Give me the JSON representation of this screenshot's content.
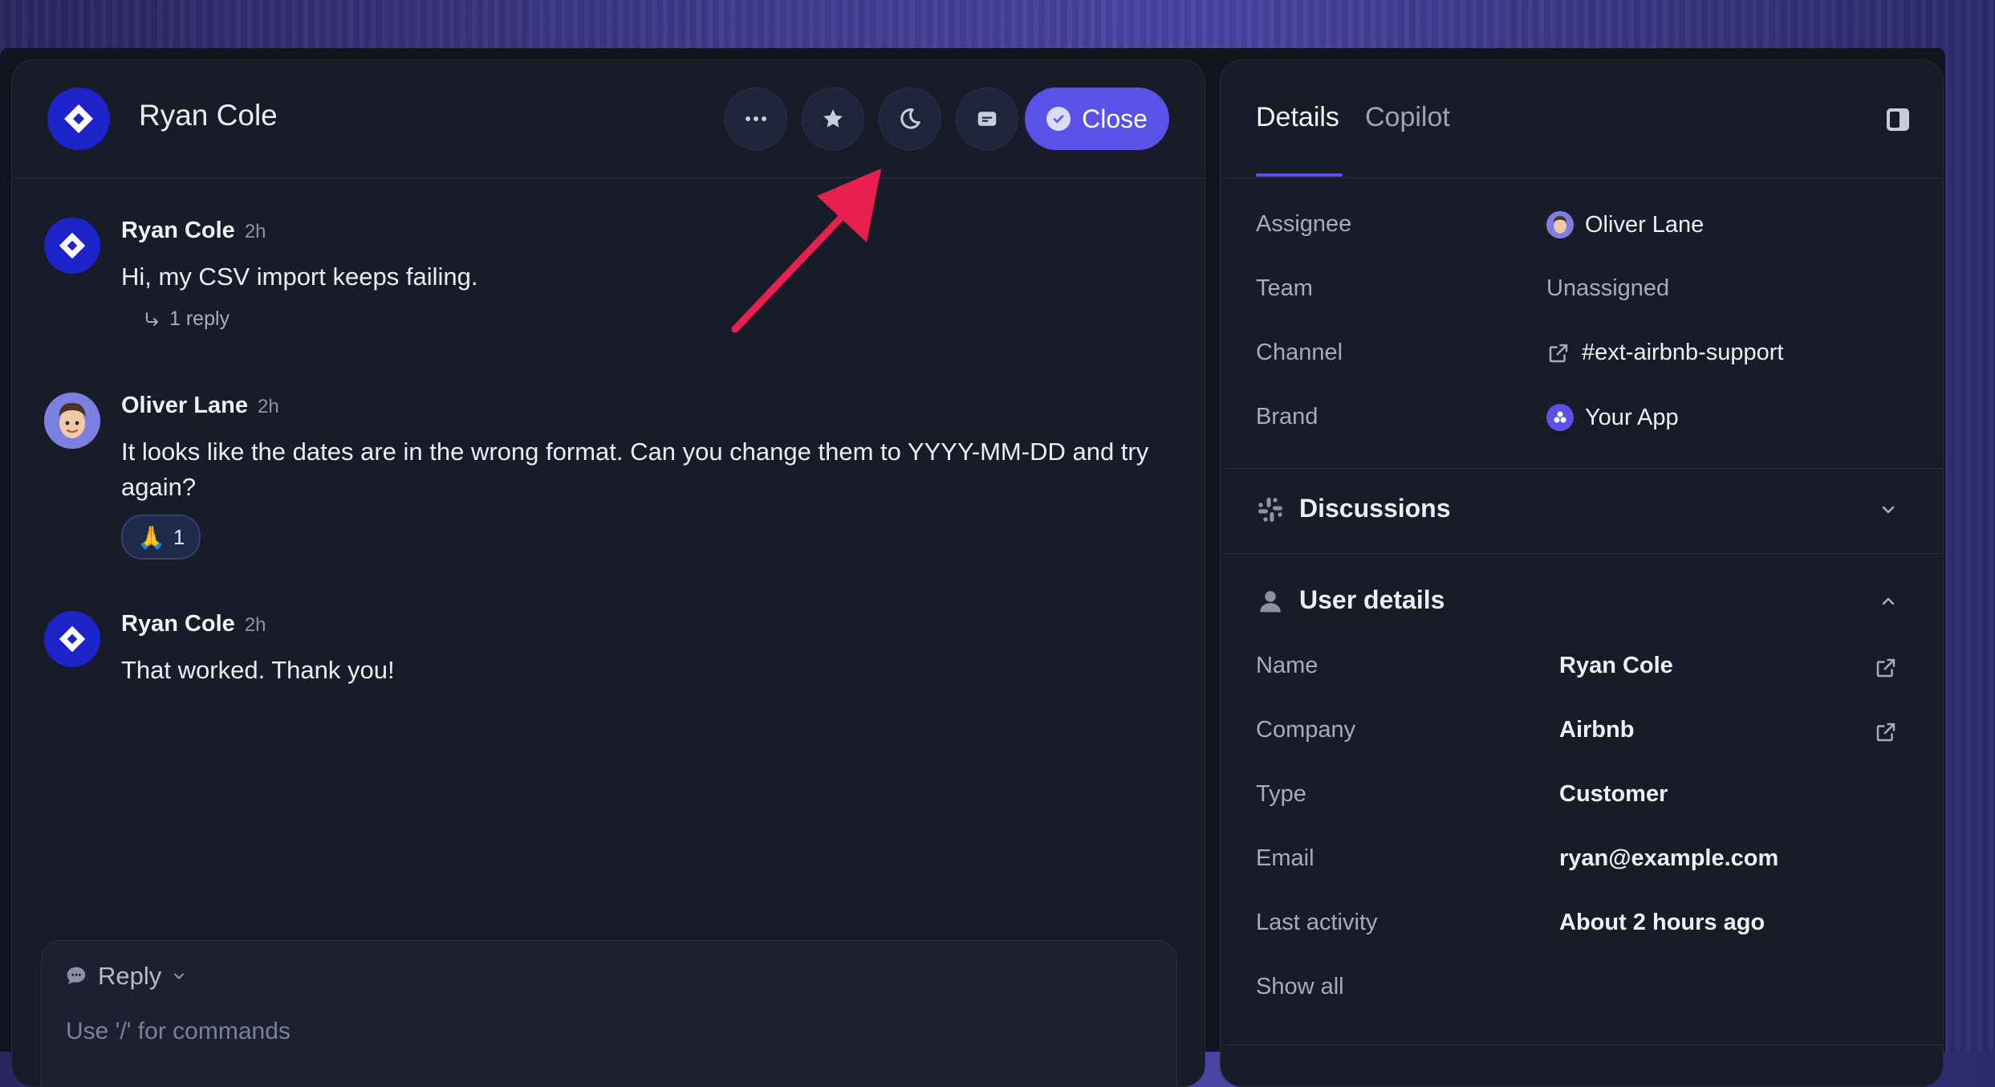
{
  "conversation": {
    "title": "Ryan Cole",
    "close_label": "Close",
    "header_buttons": [
      "more-icon",
      "star-icon",
      "moon-icon",
      "ticket-icon"
    ]
  },
  "messages": [
    {
      "author": "Ryan Cole",
      "time": "2h",
      "body": "Hi, my CSV import keeps failing.",
      "reply_label": "1 reply"
    },
    {
      "author": "Oliver Lane",
      "time": "2h",
      "body": "It looks like the dates are in the wrong format. Can you change them to YYYY-MM-DD and try again?",
      "reaction_emoji": "🙏",
      "reaction_count": "1"
    },
    {
      "author": "Ryan Cole",
      "time": "2h",
      "body": "That worked. Thank you!"
    }
  ],
  "composer": {
    "mode_label": "Reply",
    "placeholder": "Use '/' for commands"
  },
  "details": {
    "tabs": [
      {
        "label": "Details",
        "active": true
      },
      {
        "label": "Copilot",
        "active": false
      }
    ],
    "fields": [
      {
        "label": "Assignee",
        "value": "Oliver Lane"
      },
      {
        "label": "Team",
        "value": "Unassigned"
      },
      {
        "label": "Channel",
        "value": "#ext-airbnb-support"
      },
      {
        "label": "Brand",
        "value": "Your App"
      }
    ],
    "discussions_title": "Discussions",
    "user_details_title": "User details",
    "user_fields": [
      {
        "label": "Name",
        "value": "Ryan Cole"
      },
      {
        "label": "Company",
        "value": "Airbnb"
      },
      {
        "label": "Type",
        "value": "Customer"
      },
      {
        "label": "Email",
        "value": "ryan@example.com"
      },
      {
        "label": "Last activity",
        "value": "About 2 hours ago"
      }
    ],
    "show_all_label": "Show all"
  },
  "colors": {
    "accent": "#5a52e8",
    "brand_avatar": "#1d24c9",
    "annotation_arrow": "#e8204f"
  }
}
